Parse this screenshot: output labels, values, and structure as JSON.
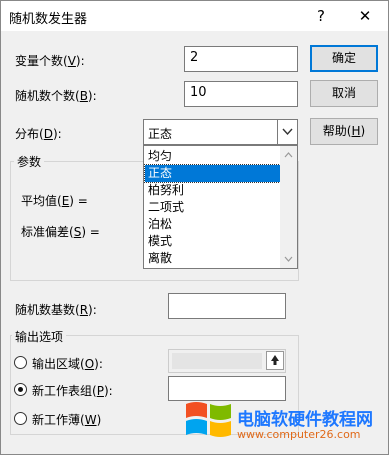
{
  "window": {
    "title": "随机数发生器",
    "help_glyph": "?",
    "close_glyph": "✕"
  },
  "fields": {
    "variable_count": {
      "label_main": "变量个数(",
      "key": "V",
      "label_end": "):",
      "value": "2"
    },
    "random_count": {
      "label_main": "随机数个数(",
      "key": "B",
      "label_end": "):",
      "value": "10"
    },
    "distribution": {
      "label_main": "分布(",
      "key": "D",
      "label_end": "):",
      "selected": "正态",
      "options": [
        "均匀",
        "正态",
        "柏努利",
        "二项式",
        "泊松",
        "模式",
        "离散"
      ]
    }
  },
  "buttons": {
    "ok": "确定",
    "cancel": "取消",
    "help_main": "帮助(",
    "help_key": "H",
    "help_end": ")"
  },
  "params": {
    "title": "参数",
    "mean": {
      "label_main": "平均值(",
      "key": "E",
      "label_end": ") ="
    },
    "stddev": {
      "label_main": "标准偏差(",
      "key": "S",
      "label_end": ") ="
    }
  },
  "seed": {
    "label_main": "随机数基数(",
    "key": "R",
    "label_end": "):",
    "value": ""
  },
  "output": {
    "title": "输出选项",
    "range": {
      "label_main": "输出区域(",
      "key": "O",
      "label_end": "):",
      "selected": false
    },
    "new_sheet": {
      "label_main": "新工作表组(",
      "key": "P",
      "label_end": "):",
      "selected": true
    },
    "new_workbook": {
      "label_main": "新工作薄(",
      "key": "W",
      "label_end": ")",
      "selected": false
    }
  },
  "watermark": {
    "line1": "电脑软硬件教程网",
    "line2": "www.computer26.com"
  },
  "colors": {
    "accent": "#0078d7",
    "watermark_blue": "#1e78ff",
    "watermark_orange": "#e06a1a"
  },
  "icons": {
    "collapse": "range-selector-icon",
    "dropdown": "chevron-down-icon",
    "logo": "windows-logo-icon"
  }
}
